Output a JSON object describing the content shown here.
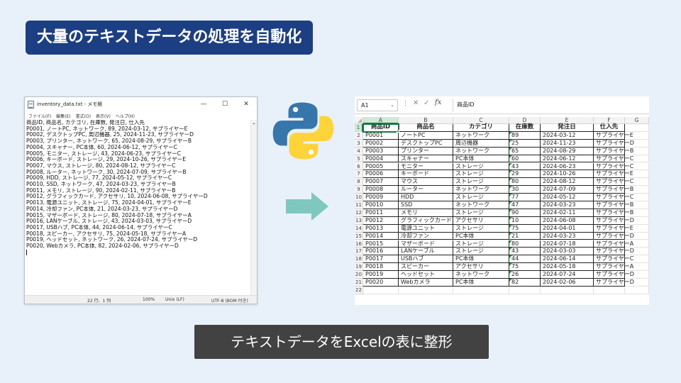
{
  "title": "大量のテキストデータの処理を自動化",
  "caption": "テキストデータをExcelの表に整形",
  "colors": {
    "title_bg": "#1c3f84",
    "caption_bg": "#424242",
    "arrow": "#7ec8c0",
    "excel_green": "#107c41",
    "python_blue": "#3776ab",
    "python_yellow": "#ffd43b"
  },
  "notepad": {
    "title": "inventory_data.txt - メモ帳",
    "controls": [
      "—",
      "☐",
      "✕"
    ],
    "menu": [
      "ファイル(F)",
      "編集(E)",
      "書式(O)",
      "表示(V)",
      "ヘルプ(H)"
    ],
    "lines": [
      "商品ID, 商品名, カテゴリ, 在庫数, 発注日, 仕入先",
      "P0001, ノートPC, ネットワーク, 89, 2024-03-12, サプライヤーE",
      "P0002, デスクトップPC, 周辺機器, 25, 2024-11-23, サプライヤーD",
      "P0003, プリンター, ネットワーク, 65, 2024-08-29, サプライヤーB",
      "P0004, スキャナー, PC本体, 60, 2024-06-12, サプライヤーC",
      "P0005, モニター, ストレージ, 43, 2024-06-23, サプライヤーC",
      "P0006, キーボード, ストレージ, 29, 2024-10-26, サプライヤーE",
      "P0007, マウス, ストレージ, 80, 2024-08-12, サプライヤーC",
      "P0008, ルーター, ネットワーク, 30, 2024-07-09, サプライヤーB",
      "P0009, HDD, ストレージ, 77, 2024-05-12, サプライヤーC",
      "P0010, SSD, ネットワーク, 47, 2024-03-23, サプライヤーB",
      "P0011, メモリ, ストレージ, 90, 2024-02-11, サプライヤーB",
      "P0012, グラフィックカード, アクセサリ, 10, 2024-06-08, サプライヤーD",
      "P0013, 電源ユニット, ストレージ, 75, 2024-04-01, サプライヤーE",
      "P0014, 冷却ファン, PC本体, 21, 2024-03-23, サプライヤーD",
      "P0015, マザーボード, ストレージ, 80, 2024-07-18, サプライヤーA",
      "P0016, LANケーブル, ストレージ, 43, 2024-03-03, サプライヤーD",
      "P0017, USBハブ, PC本体, 44, 2024-06-14, サプライヤーC",
      "P0018, スピーカー, アクセサリ, 75, 2024-05-18, サプライヤーA",
      "P0019, ヘッドセット, ネットワーク, 26, 2024-07-24, サプライヤーD",
      "P0020, Webカメラ, PC本体, 82, 2024-02-06, サプライヤーD"
    ],
    "status": {
      "position": "22 行、1 列",
      "zoom": "100%",
      "line_ending": "Unix (LF)",
      "encoding": "UTF-8 (BOM 付き)"
    }
  },
  "excel": {
    "name_box": "A1",
    "formula": "商品ID",
    "columns": [
      "A",
      "B",
      "C",
      "D",
      "E",
      "F",
      "G"
    ],
    "row_numbers": [
      "1",
      "2",
      "3",
      "4",
      "5",
      "6",
      "7",
      "8",
      "9",
      "10",
      "11",
      "12",
      "13",
      "14",
      "15",
      "16",
      "17",
      "18",
      "19",
      "20",
      "21",
      "22"
    ],
    "header": [
      "商品ID",
      "商品名",
      "カテゴリ",
      "在庫数",
      "発注日",
      "仕入先"
    ],
    "rows": [
      [
        "P0001",
        "ノートPC",
        "ネットワーク",
        "89",
        "2024-03-12",
        "サプライヤーE"
      ],
      [
        "P0002",
        "デスクトップPC",
        "周辺機器",
        "25",
        "2024-11-23",
        "サプライヤーD"
      ],
      [
        "P0003",
        "プリンター",
        "ネットワーク",
        "65",
        "2024-08-29",
        "サプライヤーB"
      ],
      [
        "P0004",
        "スキャナー",
        "PC本体",
        "60",
        "2024-06-12",
        "サプライヤーC"
      ],
      [
        "P0005",
        "モニター",
        "ストレージ",
        "43",
        "2024-06-23",
        "サプライヤーC"
      ],
      [
        "P0006",
        "キーボード",
        "ストレージ",
        "29",
        "2024-10-26",
        "サプライヤーE"
      ],
      [
        "P0007",
        "マウス",
        "ストレージ",
        "80",
        "2024-08-12",
        "サプライヤーC"
      ],
      [
        "P0008",
        "ルーター",
        "ネットワーク",
        "30",
        "2024-07-09",
        "サプライヤーB"
      ],
      [
        "P0009",
        "HDD",
        "ストレージ",
        "77",
        "2024-05-12",
        "サプライヤーC"
      ],
      [
        "P0010",
        "SSD",
        "ネットワーク",
        "47",
        "2024-03-23",
        "サプライヤーB"
      ],
      [
        "P0011",
        "メモリ",
        "ストレージ",
        "90",
        "2024-02-11",
        "サプライヤーB"
      ],
      [
        "P0012",
        "グラフィックカード",
        "アクセサリ",
        "10",
        "2024-06-08",
        "サプライヤーD"
      ],
      [
        "P0013",
        "電源ユニット",
        "ストレージ",
        "75",
        "2024-04-01",
        "サプライヤーE"
      ],
      [
        "P0014",
        "冷却ファン",
        "PC本体",
        "21",
        "2024-03-23",
        "サプライヤーD"
      ],
      [
        "P0015",
        "マザーボード",
        "ストレージ",
        "80",
        "2024-07-18",
        "サプライヤーA"
      ],
      [
        "P0016",
        "LANケーブル",
        "ストレージ",
        "43",
        "2024-03-03",
        "サプライヤーD"
      ],
      [
        "P0017",
        "USBハブ",
        "PC本体",
        "44",
        "2024-06-14",
        "サプライヤーC"
      ],
      [
        "P0018",
        "スピーカー",
        "アクセサリ",
        "75",
        "2024-05-18",
        "サプライヤーA"
      ],
      [
        "P0019",
        "ヘッドセット",
        "ネットワーク",
        "26",
        "2024-07-24",
        "サプライヤーD"
      ],
      [
        "P0020",
        "Webカメラ",
        "PC本体",
        "82",
        "2024-02-06",
        "サプライヤーD"
      ]
    ]
  }
}
